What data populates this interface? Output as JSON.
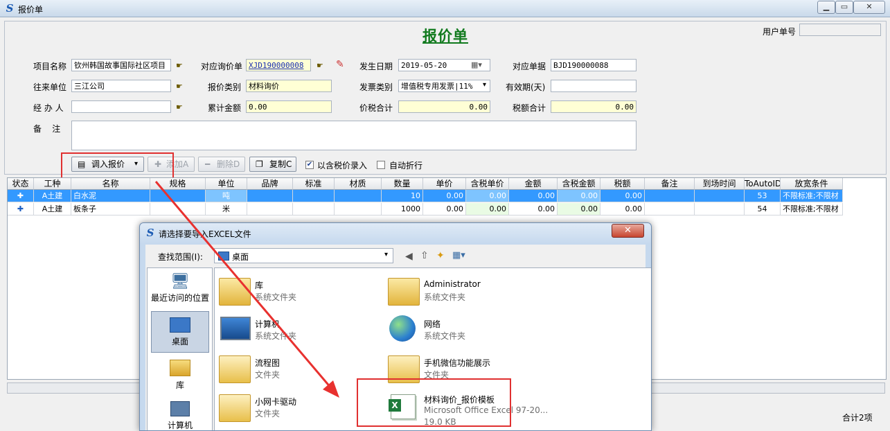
{
  "window": {
    "title": "报价单"
  },
  "form": {
    "heading": "报价单",
    "user_no_label": "用户单号",
    "project_label": "项目名称",
    "project_value": "钦州韩国故事国际社区项目",
    "partner_label": "往来单位",
    "partner_value": "三江公司",
    "handler_label": "经 办 人",
    "handler_value": "",
    "remark_label": "备    注",
    "remark_value": "",
    "inquiry_label": "对应询价单",
    "inquiry_value": "XJD190000008",
    "quote_type_label": "报价类别",
    "quote_type_value": "材料询价",
    "total_label": "累计金额",
    "total_value": "0.00",
    "date_label": "发生日期",
    "date_value": "2019-05-20",
    "invoice_label": "发票类别",
    "invoice_value": "增值税专用发票|11%",
    "taxsum_label": "价税合计",
    "taxsum_value": "0.00",
    "doc_label": "对应单据",
    "doc_value": "BJD190000088",
    "valid_label": "有效期(天)",
    "valid_value": "",
    "tax_label": "税额合计",
    "tax_value": "0.00"
  },
  "toolbar": {
    "import_label": "调入报价",
    "add_label": "添加A",
    "delete_label": "删除D",
    "copy_label": "复制C",
    "tax_entry_label": "以含税价录入",
    "auto_discount_label": "自动折行"
  },
  "grid": {
    "columns": [
      "状态",
      "工种",
      "名称",
      "规格",
      "单位",
      "品牌",
      "标准",
      "材质",
      "数量",
      "单价",
      "含税单价",
      "金额",
      "含税金额",
      "税额",
      "备注",
      "到场时间",
      "ToAutoID",
      "放宽条件"
    ],
    "rows": [
      {
        "work": "A土建",
        "name": "白水泥",
        "spec": "",
        "unit": "吨",
        "brand": "",
        "std": "",
        "mat": "",
        "qty": "10",
        "price": "0.00",
        "taxprice": "0.00",
        "amount": "0.00",
        "taxamount": "0.00",
        "tax": "0.00",
        "note": "",
        "arrive": "",
        "autoid": "53",
        "relax": "不限标准;不限材"
      },
      {
        "work": "A土建",
        "name": "板条子",
        "spec": "",
        "unit": "米",
        "brand": "",
        "std": "",
        "mat": "",
        "qty": "1000",
        "price": "0.00",
        "taxprice": "0.00",
        "amount": "0.00",
        "taxamount": "0.00",
        "tax": "0.00",
        "note": "",
        "arrive": "",
        "autoid": "54",
        "relax": "不限标准;不限材"
      }
    ],
    "footer_count": "合计2项"
  },
  "dialog": {
    "title": "请选择要导入EXCEL文件",
    "lookin_label": "查找范围(I):",
    "lookin_value": "桌面",
    "places": [
      {
        "label": "最近访问的位置"
      },
      {
        "label": "桌面"
      },
      {
        "label": "库"
      },
      {
        "label": "计算机"
      }
    ],
    "files": [
      {
        "name": "库",
        "type": "系统文件夹"
      },
      {
        "name": "Administrator",
        "type": "系统文件夹"
      },
      {
        "name": "计算机",
        "type": "系统文件夹"
      },
      {
        "name": "网络",
        "type": "系统文件夹"
      },
      {
        "name": "流程图",
        "type": "文件夹"
      },
      {
        "name": "手机微信功能展示",
        "type": "文件夹"
      },
      {
        "name": "小网卡驱动",
        "type": "文件夹"
      },
      {
        "name": "材料询价_报价模板",
        "type": "Microsoft Office Excel 97-20...",
        "size": "19.0 KB"
      }
    ]
  },
  "colors": {
    "heading": "#117a1e",
    "selection": "#3399ff",
    "annotation": "#e03030"
  }
}
